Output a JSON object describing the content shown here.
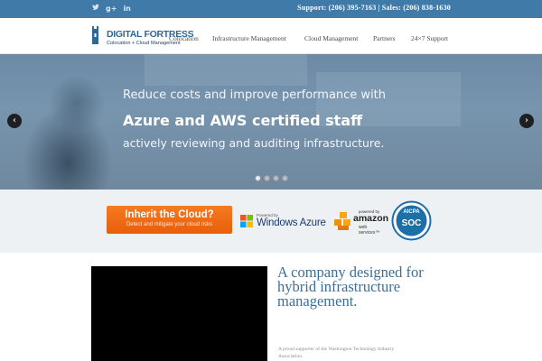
{
  "topbar": {
    "social": [
      {
        "icon": "twitter-icon",
        "glyph": "🐦"
      },
      {
        "icon": "google-plus-icon",
        "glyph": "g+"
      },
      {
        "icon": "linkedin-icon",
        "glyph": "in"
      }
    ],
    "support_text": "Support: (206) 395-7163 | Sales: (206) 838-1630"
  },
  "header": {
    "logo_title": "DIGITAL FORTRESS",
    "logo_subtitle": "Colocation + Cloud Management",
    "nav": [
      "Colocation",
      "Infrastructure Management",
      "Cloud Management",
      "Partners",
      "24×7 Support"
    ]
  },
  "hero": {
    "line1": "Reduce costs and improve performance with",
    "line2": "Azure and AWS certified staff",
    "line3": "actively reviewing and auditing infrastructure.",
    "prev_glyph": "‹",
    "next_glyph": "›",
    "active_slide": 1,
    "slide_count": 4
  },
  "partners": {
    "cta_title": "Inherit the Cloud?",
    "cta_subtitle": "Detect and mitigate your cloud risks",
    "azure_small": "Powered by",
    "azure_name": "Windows Azure",
    "aws_small": "powered by",
    "aws_name": "amazon",
    "aws_sub": "web services™",
    "soc_top": "AICPA",
    "soc_mid": "SOC"
  },
  "content": {
    "headline": "A company designed for hybrid infrastructure management.",
    "supporter": "A proud supporter of the Washington Technology Industry Association."
  },
  "colors": {
    "topbar": "#3f7aa8",
    "brand_blue": "#2f6896",
    "cta_orange": "#f06d16",
    "headline_blue": "#3a6f9a"
  }
}
